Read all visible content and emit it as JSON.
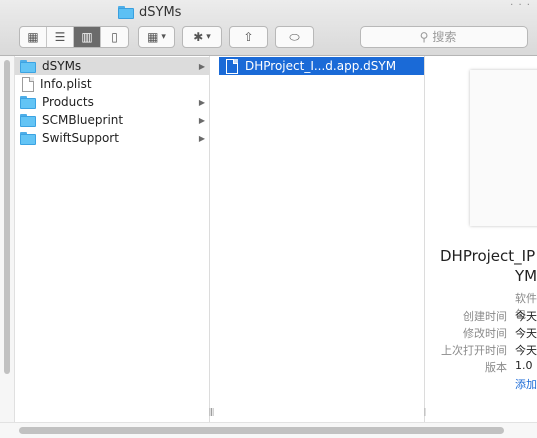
{
  "window": {
    "title": "dSYMs",
    "more_indicator": "· · ·"
  },
  "toolbar": {
    "view_icons": [
      "icon-view-icon",
      "list-view-icon",
      "column-view-icon",
      "cover-flow-icon"
    ],
    "view_glyphs": [
      "▦",
      "☰",
      "▥",
      "▯"
    ],
    "arrange_glyph": "▦",
    "arrange_caret": "▾",
    "action_glyph": "✱",
    "action_caret": "▾",
    "share_glyph": "⇧",
    "tag_glyph": "⬭",
    "search_glyph": "⚲",
    "search_placeholder": "搜索"
  },
  "column1": {
    "items": [
      {
        "label": "dSYMs",
        "type": "folder",
        "has_children": true,
        "selected": true
      },
      {
        "label": "Info.plist",
        "type": "file",
        "has_children": false,
        "selected": false
      },
      {
        "label": "Products",
        "type": "folder",
        "has_children": true,
        "selected": false
      },
      {
        "label": "SCMBlueprint",
        "type": "folder",
        "has_children": true,
        "selected": false
      },
      {
        "label": "SwiftSupport",
        "type": "folder",
        "has_children": true,
        "selected": false
      }
    ]
  },
  "column2": {
    "items": [
      {
        "label": "DHProject_I...d.app.dSYM",
        "type": "file",
        "selected": true
      }
    ]
  },
  "preview": {
    "name_line1": "DHProject_IP",
    "name_line2": "YM",
    "kind": "软件包",
    "meta": [
      {
        "key": "创建时间",
        "value": "今天"
      },
      {
        "key": "修改时间",
        "value": "今天"
      },
      {
        "key": "上次打开时间",
        "value": "今天"
      },
      {
        "key": "版本",
        "value": "1.0"
      }
    ],
    "more_link": "添加"
  },
  "glyphs": {
    "chevron": "▶",
    "resize": "||"
  },
  "colors": {
    "selection_blue": "#1a6ad7",
    "selection_gray": "#dcdcdc",
    "folder_blue": "#63c4f5"
  }
}
